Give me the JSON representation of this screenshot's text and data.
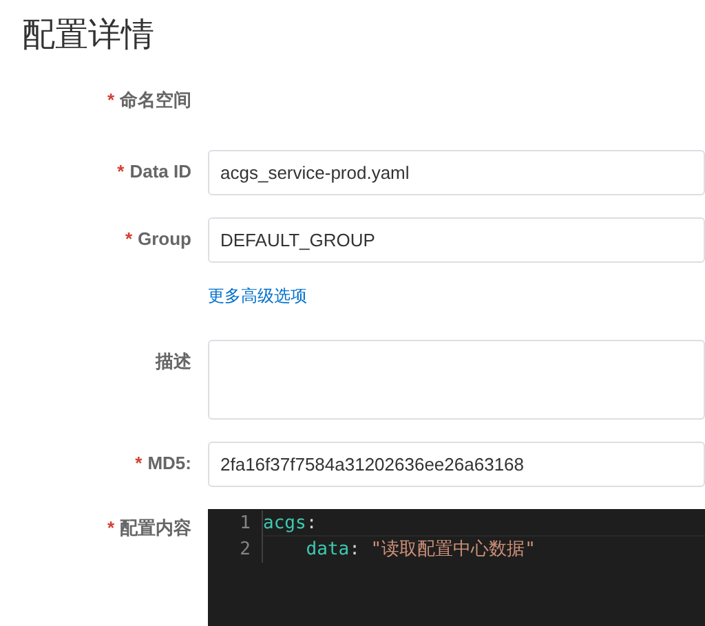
{
  "title": "配置详情",
  "form": [
    {
      "kind": "static",
      "required_mark": "*",
      "label": "命名空间"
    },
    {
      "kind": "input",
      "required_mark": "*",
      "label": "Data ID",
      "value": "acgs_service-prod.yaml"
    },
    {
      "kind": "input",
      "required_mark": "*",
      "label": "Group",
      "value": "DEFAULT_GROUP"
    },
    {
      "kind": "link",
      "text": "更多高级选项"
    },
    {
      "kind": "textarea",
      "label": "描述"
    },
    {
      "kind": "input",
      "required_mark": "*",
      "label": "MD5:",
      "value": "2fa16f37f7584a31202636ee26a63168"
    },
    {
      "kind": "code",
      "required_mark": "*",
      "label": "配置内容",
      "lines": [
        {
          "number": "1",
          "tokens": [
            {
              "text": "acgs",
              "color": "#3dc9b0"
            },
            {
              "text": ":",
              "color": "#d4d4d4"
            }
          ],
          "children": [
            {
              "number": "2",
              "tokens": [
                {
                  "text": "data",
                  "color": "#3dc9b0"
                },
                {
                  "text": ": ",
                  "color": "#d4d4d4"
                },
                {
                  "text": "\"读取配置中心数据\"",
                  "color": "#ce9178"
                }
              ]
            }
          ]
        }
      ]
    }
  ]
}
